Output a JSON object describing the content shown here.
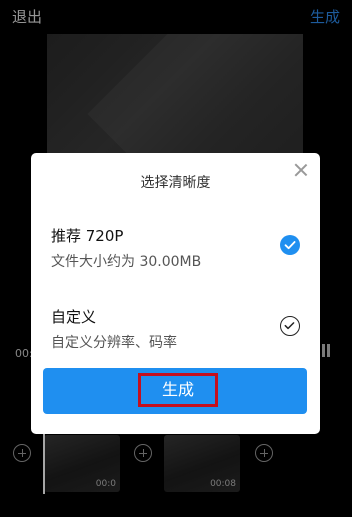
{
  "topbar": {
    "exit_label": "退出",
    "generate_label": "生成"
  },
  "player": {
    "time_left": "00:"
  },
  "timeline": {
    "clips": [
      {
        "duration": "00:0"
      },
      {
        "duration": "00:08"
      }
    ]
  },
  "dialog": {
    "title": "选择清晰度",
    "options": [
      {
        "title": "推荐 720P",
        "description": "文件大小约为 30.00MB",
        "selected": true
      },
      {
        "title": "自定义",
        "description": "自定义分辨率、码率",
        "selected": false
      }
    ],
    "generate_label": "生成"
  },
  "colors": {
    "accent": "#1f8ff0",
    "highlight_border": "#c40f1f"
  }
}
